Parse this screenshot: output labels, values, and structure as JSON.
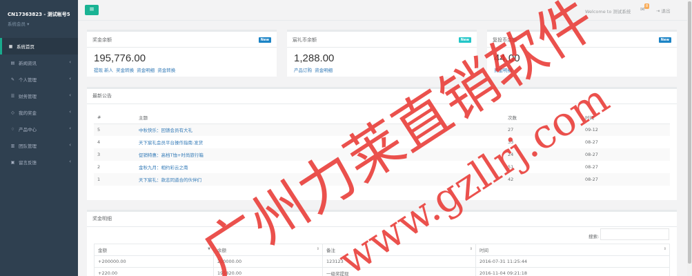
{
  "sidebar": {
    "account": "CN17363823 - 测试帐号5",
    "role": "系统会员 ▾",
    "items": [
      {
        "label": "系统首页",
        "icon": "dashboard-icon",
        "glyph": "▦"
      },
      {
        "label": "新闻资讯",
        "icon": "news-icon",
        "glyph": "▤"
      },
      {
        "label": "个人管理",
        "icon": "edit-icon",
        "glyph": "✎"
      },
      {
        "label": "财务管理",
        "icon": "finance-icon",
        "glyph": "☰"
      },
      {
        "label": "我的奖金",
        "icon": "diamond-icon",
        "glyph": "◇"
      },
      {
        "label": "产品中心",
        "icon": "tag-icon",
        "glyph": "♢"
      },
      {
        "label": "团队管理",
        "icon": "bank-icon",
        "glyph": "▥"
      },
      {
        "label": "留言反馈",
        "icon": "comment-icon",
        "glyph": "▣"
      }
    ]
  },
  "topbar": {
    "menu_glyph": "≡",
    "welcome": "Welcome to 测试系统",
    "mail_badge": "8",
    "logout": "退出",
    "logout_glyph": "⇥"
  },
  "stats": [
    {
      "title": "奖金余额",
      "badge": "New",
      "badge_color": "#1c84c6",
      "value": "195,776.00",
      "links": [
        "提现",
        "新人",
        "奖金转换",
        "资金明细",
        "资金转换"
      ]
    },
    {
      "title": "宸礼币余额",
      "badge": "New",
      "badge_color": "#23c6c8",
      "value": "1,288.00",
      "links": [
        "产品订购",
        "资金明细"
      ]
    },
    {
      "title": "复投币余额",
      "badge": "New",
      "badge_color": "#1c84c6",
      "value": "44.00",
      "links": [
        "资金明细"
      ]
    }
  ],
  "announcements": {
    "title": "最新公告",
    "columns": [
      "#",
      "主题",
      "次数",
      "时间"
    ],
    "rows": [
      {
        "n": "5",
        "subject": "中秋快乐：回馈会员有大礼",
        "count": "27",
        "date": "09-12"
      },
      {
        "n": "4",
        "subject": "天下宸礼会员平台操作指南:发货",
        "count": "33",
        "date": "08-27"
      },
      {
        "n": "3",
        "subject": "促销特惠：高档T恤+时尚旅行箱",
        "count": "24",
        "date": "08-27"
      },
      {
        "n": "2",
        "subject": "金秋九月：相约彩云之南",
        "count": "51",
        "date": "08-27"
      },
      {
        "n": "1",
        "subject": "天下宸礼：款志同道合的伙伴们",
        "count": "42",
        "date": "08-27"
      }
    ]
  },
  "bonus": {
    "title": "奖金明细",
    "search_label": "搜索:",
    "columns": [
      "金额",
      "余额",
      "备注",
      "时间"
    ],
    "rows": [
      {
        "amount": "+200000.00",
        "balance": "200000.00",
        "note": "123123",
        "time": "2016-07-31 11:25:44"
      },
      {
        "amount": "+220.00",
        "balance": "195820.00",
        "note": "一级奖提现",
        "time": "2016-11-04 09:21:18"
      }
    ]
  },
  "watermark": {
    "cn": "广州力莱直销软件",
    "url": "www.gzllrj.com",
    "color": "#e8322e"
  }
}
